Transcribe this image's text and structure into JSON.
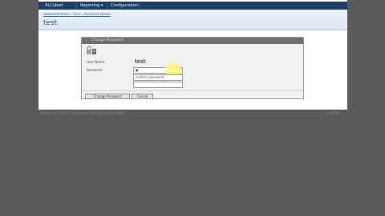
{
  "nav": {
    "tabs": [
      {
        "label": "XLCubed Home"
      },
      {
        "label": "Reporting ▾"
      },
      {
        "label": "Configuration ▾"
      }
    ]
  },
  "header": {
    "breadcrumb": "administration › Test › Account Home",
    "title": "test"
  },
  "dialog": {
    "title": "Change Password",
    "user_name_label": "User Name:",
    "user_name_value": "test",
    "password_label": "Password:",
    "password_value": "●",
    "confirm_placeholder": "confirm password",
    "change_button": "Change Password",
    "cancel_button": "Cancel"
  },
  "status": {
    "left": "Version 1.0.0.0 · Copyright XLCubed Ltd 2008",
    "right": "Log Off"
  },
  "colors": {
    "nav_bg": "#1d3f66",
    "title_blue": "#2b5e97",
    "page_bg": "#5b5b5b",
    "highlight": "#fff678"
  }
}
